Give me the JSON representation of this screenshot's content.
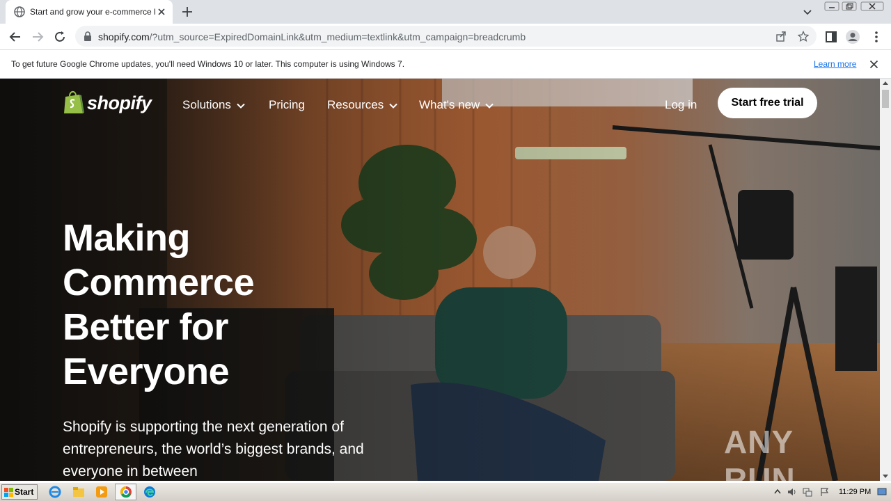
{
  "browser": {
    "tab_title": "Start and grow your e-commerce bu",
    "url_host": "shopify.com",
    "url_rest": "/?utm_source=ExpiredDomainLink&utm_medium=textlink&utm_campaign=breadcrumb",
    "infobar_message": "To get future Google Chrome updates, you'll need Windows 10 or later. This computer is using Windows 7.",
    "infobar_link": "Learn more"
  },
  "site": {
    "logo_text": "shopify",
    "nav": {
      "solutions": "Solutions",
      "pricing": "Pricing",
      "resources": "Resources",
      "whats_new": "What's new",
      "login": "Log in",
      "trial": "Start free trial"
    },
    "hero": {
      "title_line1": "Making",
      "title_line2": "Commerce",
      "title_line3": "Better for",
      "title_line4": "Everyone",
      "subtitle": "Shopify is supporting the next generation of entrepreneurs, the world’s biggest brands, and everyone in between"
    },
    "watermark": "ANY RUN"
  },
  "taskbar": {
    "start_label": "Start",
    "clock": "11:29 PM"
  },
  "colors": {
    "accent_green": "#95bf47",
    "link_blue": "#1a73e8",
    "tabstrip_bg": "#dee1e6"
  }
}
